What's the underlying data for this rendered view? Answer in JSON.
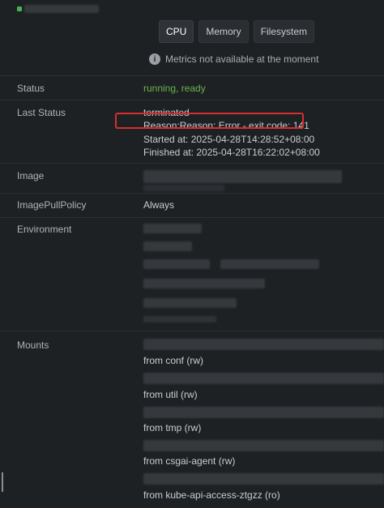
{
  "header": {
    "status_color": "#4caf50"
  },
  "tabs": [
    {
      "label": "CPU"
    },
    {
      "label": "Memory"
    },
    {
      "label": "Filesystem"
    }
  ],
  "metrics_note": "Metrics not available at the moment",
  "details": {
    "status_label": "Status",
    "status_value": "running, ready",
    "last_status_label": "Last Status",
    "last_status": {
      "state": "terminated",
      "reason": "Reason:Reason: Error - exit code: 141",
      "started": "Started at: 2025-04-28T14:28:52+08:00",
      "finished": "Finished at: 2025-04-28T16:22:02+08:00"
    },
    "image_label": "Image",
    "image_pull_policy_label": "ImagePullPolicy",
    "image_pull_policy_value": "Always",
    "environment_label": "Environment",
    "mounts_label": "Mounts",
    "mounts": [
      "from conf (rw)",
      "from util (rw)",
      "from tmp (rw)",
      "from csgai-agent (rw)",
      "from kube-api-access-ztgzz (ro)"
    ]
  }
}
